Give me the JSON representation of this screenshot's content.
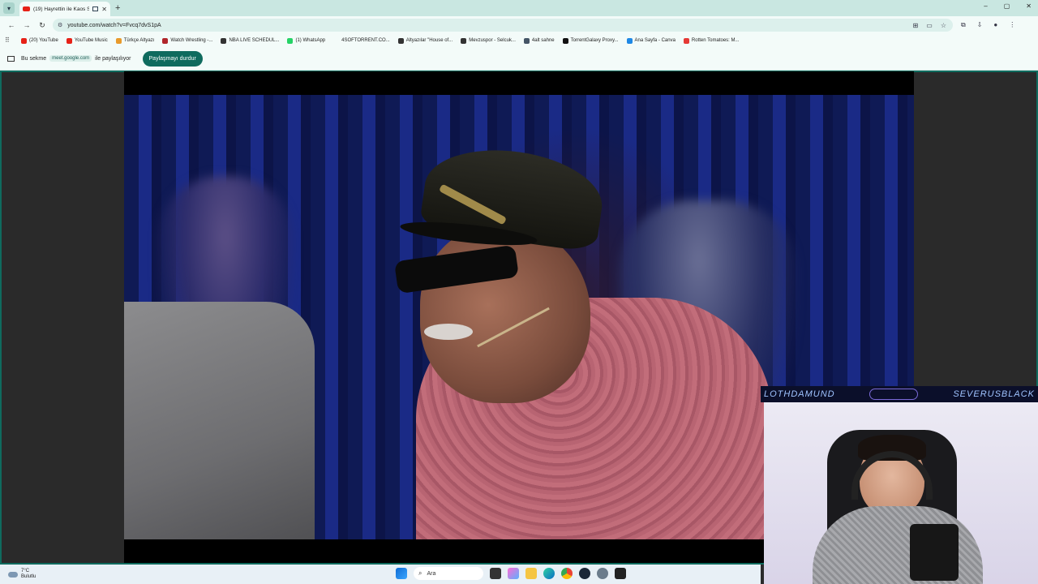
{
  "browser": {
    "tab": {
      "title": "(19) Hayrettin ile Kaos Sho..."
    },
    "new_tab_label": "+",
    "window_controls": [
      "–",
      "▢",
      "✕"
    ],
    "url": "youtube.com/watch?v=Fvcq7dvS1pA",
    "bookmarks": [
      {
        "label": "(20) YouTube",
        "color": "#e62117"
      },
      {
        "label": "YouTube Music",
        "color": "#e62117"
      },
      {
        "label": "Türkçe Altyazı",
        "color": "#e89a2c"
      },
      {
        "label": "Watch Wrestling -...",
        "color": "#b0262b"
      },
      {
        "label": "NBA LIVE SCHEDUL...",
        "color": "#333333"
      },
      {
        "label": "(1) WhatsApp",
        "color": "#25d366"
      },
      {
        "label": "4SOFTORRENT.CO...",
        "color": "#f3fbf9"
      },
      {
        "label": "Altyazılar \"House of...",
        "color": "#333333"
      },
      {
        "label": "Mevzuspor - Selcuk...",
        "color": "#333333"
      },
      {
        "label": "4alt sahne",
        "color": "#456"
      },
      {
        "label": "TorrentGalaxy Proxy...",
        "color": "#111111"
      },
      {
        "label": "Ana Sayfa - Canva",
        "color": "#1e88e5"
      },
      {
        "label": "Rotten Tomatoes: M...",
        "color": "#e53935"
      }
    ]
  },
  "share_bar": {
    "prefix": "Bu sekme",
    "domain": "meet.google.com",
    "suffix": "ile paylaşılıyor",
    "stop_label": "Paylaşmayı durdur"
  },
  "webcam": {
    "left_name": "LOTHDAMUND",
    "right_name": "SEVERUSBLACK"
  },
  "taskbar": {
    "weather_temp": "7°C",
    "weather_desc": "Bulutlu",
    "search_placeholder": "Ara"
  },
  "colors": {
    "tabstrip": "#c9e7e1",
    "share_accent": "#0f6b5e"
  }
}
